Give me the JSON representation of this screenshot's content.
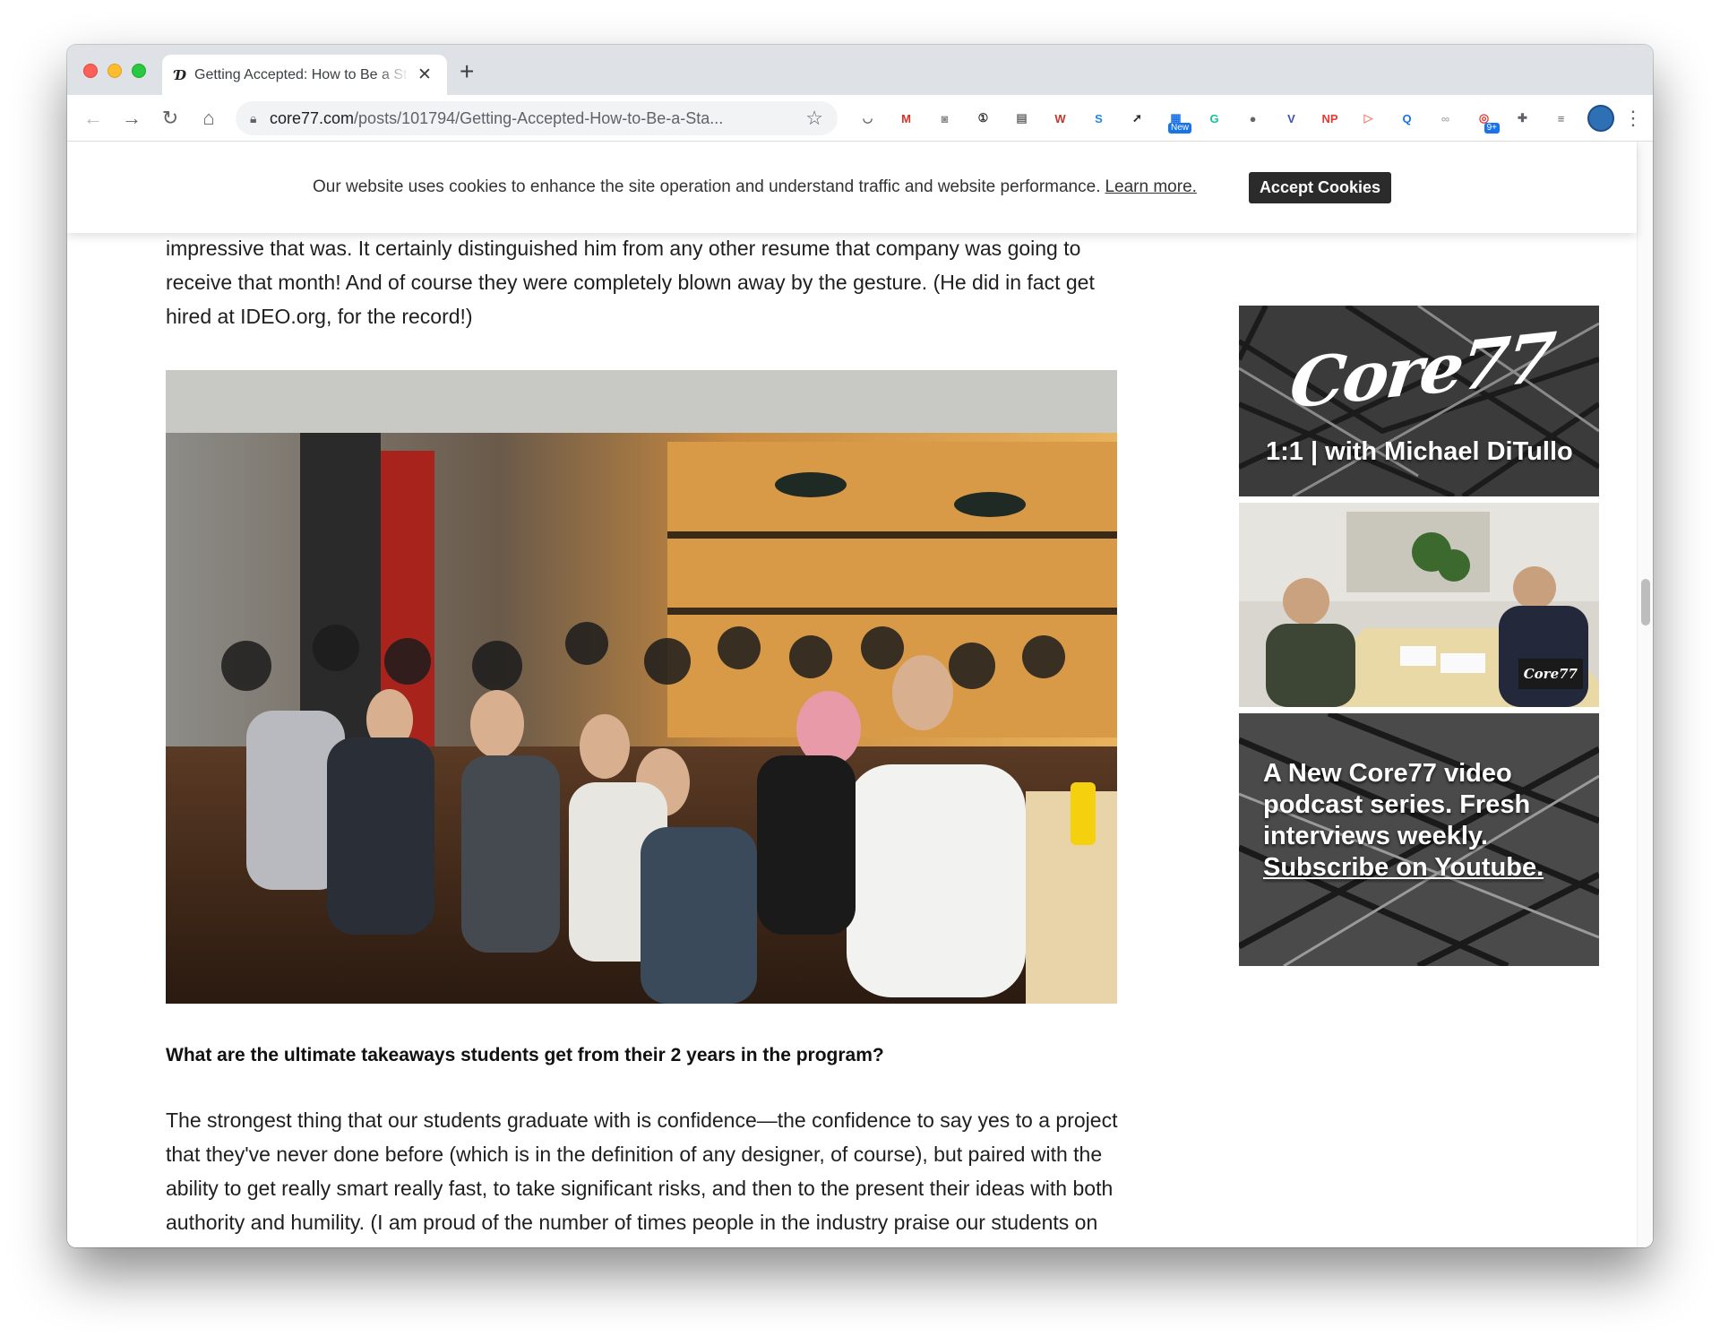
{
  "browser": {
    "tab": {
      "favicon": "Ɗ",
      "title": "Getting Accepted: How to Be a Standout Applicant",
      "close": "✕"
    },
    "new_tab": "+",
    "nav": {
      "back": "←",
      "forward": "→",
      "reload": "↻",
      "home": "⌂"
    },
    "url": {
      "host": "core77.com",
      "path": "/posts/101794/Getting-Accepted-How-to-Be-a-Sta..."
    },
    "extensions": [
      {
        "name": "pocket-icon",
        "glyph": "◡",
        "color": "#5f6368"
      },
      {
        "name": "gmail-icon",
        "glyph": "M",
        "color": "#d93025"
      },
      {
        "name": "camera-icon",
        "glyph": "◙",
        "color": "#8a8a8a"
      },
      {
        "name": "onepassword-icon",
        "glyph": "①",
        "color": "#2b2b2b"
      },
      {
        "name": "window-icon",
        "glyph": "▤",
        "color": "#6b6b6b"
      },
      {
        "name": "wolfram-icon",
        "glyph": "W",
        "color": "#c0392b"
      },
      {
        "name": "s-icon",
        "glyph": "S",
        "color": "#1e88e5"
      },
      {
        "name": "rocket-icon",
        "glyph": "➚",
        "color": "#2b2b2b"
      },
      {
        "name": "news-icon",
        "glyph": "▦",
        "color": "#1a73e8",
        "badge": "New"
      },
      {
        "name": "grammarly-icon",
        "glyph": "G",
        "color": "#15c39a"
      },
      {
        "name": "circle-icon",
        "glyph": "●",
        "color": "#666"
      },
      {
        "name": "v-icon",
        "glyph": "V",
        "color": "#3f51b5"
      },
      {
        "name": "np-icon",
        "glyph": "NP",
        "color": "#e53935"
      },
      {
        "name": "play-icon",
        "glyph": "▷",
        "color": "#f28b82"
      },
      {
        "name": "search-ext-icon",
        "glyph": "Q",
        "color": "#1a73e8"
      },
      {
        "name": "glasses-icon",
        "glyph": "∞",
        "color": "#b0b0b0"
      },
      {
        "name": "target-icon",
        "glyph": "◎",
        "color": "#e53935",
        "badge": "9+"
      },
      {
        "name": "puzzle-icon",
        "glyph": "✚",
        "color": "#5f6368"
      },
      {
        "name": "playlist-icon",
        "glyph": "≡",
        "color": "#5f6368"
      }
    ],
    "menu": "⋮"
  },
  "cookie_bar": {
    "text": "Our website uses cookies to enhance the site operation and understand traffic and website performance.",
    "link": "Learn more.",
    "button": "Accept Cookies"
  },
  "article": {
    "para1": "impressive that was. It certainly distinguished him from any other resume that company was going to receive that month! And of course they were completely blown away by the gesture. (He did in fact get hired at IDEO.org, for the record!)",
    "question": "What are the ultimate takeaways students get from their 2 years in the program?",
    "para2": "The strongest thing that our students graduate with is confidence—the confidence to say yes to a project that they've never done before (which is in the definition of any designer, of course), but paired with the ability to get really smart really fast, to take significant risks, and then to the present their ideas with both authority and humility. (I am proud of the number of times people in the industry praise our students on their presentation skills.) F"
  },
  "sidebar": {
    "card1": {
      "logo": "Core77",
      "subtitle": "1:1 | with Michael DiTullo"
    },
    "card2": {
      "logo": "Core77"
    },
    "card3": {
      "text": "A New Core77 video podcast series. Fresh interviews weekly.",
      "link": "Subscribe on Youtube."
    }
  },
  "colors": {
    "accent": "#2b2b2b",
    "tabstrip": "#dee1e6"
  }
}
